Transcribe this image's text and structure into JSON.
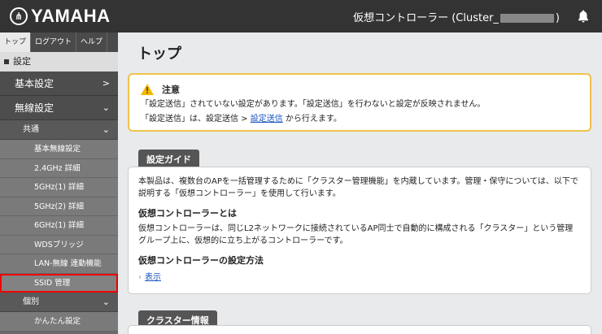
{
  "header": {
    "logo_text": "YAMAHA",
    "title_prefix": "仮想コントローラー (Cluster_",
    "title_suffix": ")"
  },
  "sidebar": {
    "tabs": [
      "トップ",
      "ログアウト",
      "ヘルプ"
    ],
    "section": "設定",
    "items": {
      "basic": "基本設定",
      "wireless": "無線設定",
      "common": "共通",
      "individual": "個別"
    },
    "common_items": [
      "基本無線設定",
      "2.4GHz 詳細",
      "5GHz(1) 詳細",
      "5GHz(2) 詳細",
      "6GHz(1) 詳細",
      "WDSブリッジ",
      "LAN-無線 連動機能",
      "SSID 管理"
    ],
    "individual_items": [
      "かんたん設定"
    ]
  },
  "main": {
    "title": "トップ",
    "alert": {
      "heading": "注意",
      "line1": "「設定送信」されていない設定があります。「設定送信」を行わないと設定が反映されません。",
      "line2_pre": "「設定送信」は、設定送信 > ",
      "line2_link": "設定送信",
      "line2_post": " から行えます。"
    },
    "guide": {
      "tab": "設定ガイド",
      "intro": "本製品は、複数台のAPを一括管理するために「クラスター管理機能」を内蔵しています。管理・保守については、以下で説明する「仮想コントローラー」を使用して行います。",
      "h1": "仮想コントローラーとは",
      "p1": "仮想コントローラーは、同じL2ネットワークに接続されているAP同士で自動的に構成される「クラスター」という管理グループ上に、仮想的に立ち上がるコントローラーです。",
      "h2": "仮想コントローラーの設定方法",
      "show_link": "表示"
    },
    "cluster_tab": "クラスター情報"
  }
}
